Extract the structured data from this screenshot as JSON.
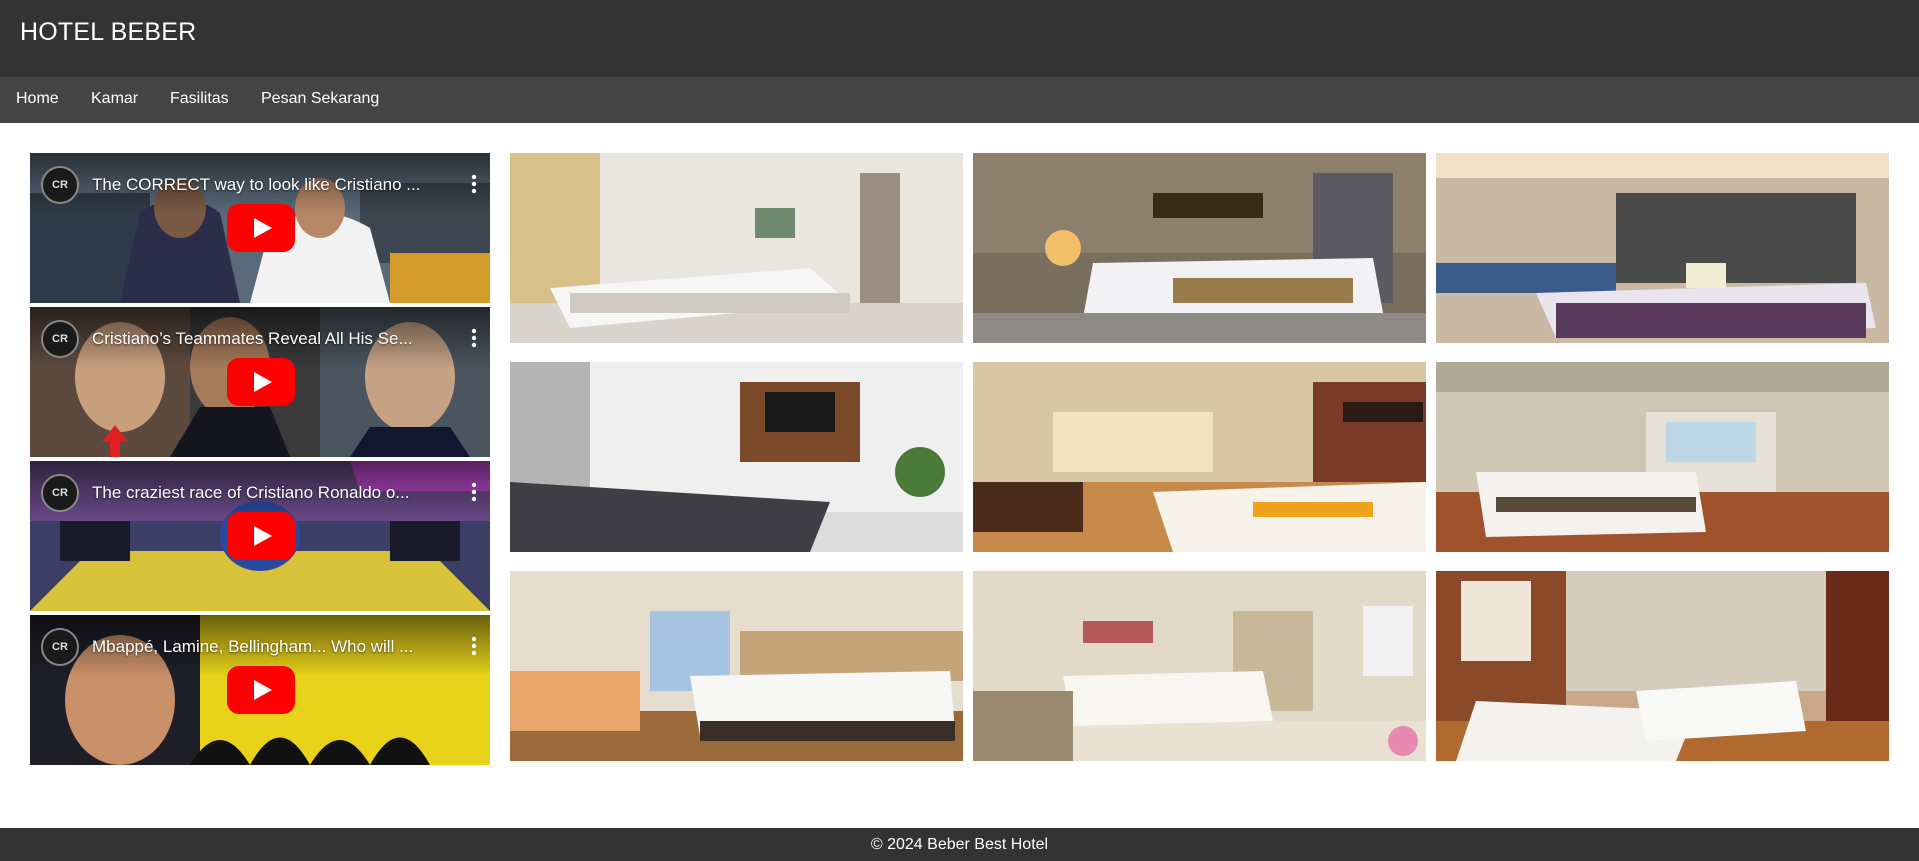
{
  "header": {
    "title": "HOTEL BEBER"
  },
  "nav": {
    "items": [
      {
        "label": "Home"
      },
      {
        "label": "Kamar"
      },
      {
        "label": "Fasilitas"
      },
      {
        "label": "Pesan Sekarang"
      }
    ]
  },
  "videos": [
    {
      "title": "The CORRECT way to look like Cristiano ...",
      "channel_badge": "CR"
    },
    {
      "title": "Cristiano’s Teammates Reveal All His Se...",
      "channel_badge": "CR"
    },
    {
      "title": "The craziest race of Cristiano Ronaldo o...",
      "channel_badge": "CR"
    },
    {
      "title": "Mbappé, Lamine, Bellingham... Who will ...",
      "channel_badge": "CR"
    }
  ],
  "rooms": [
    {
      "name": "room-photo-1"
    },
    {
      "name": "room-photo-2"
    },
    {
      "name": "room-photo-3"
    },
    {
      "name": "room-photo-4"
    },
    {
      "name": "room-photo-5"
    },
    {
      "name": "room-photo-6"
    },
    {
      "name": "room-photo-7"
    },
    {
      "name": "room-photo-8"
    },
    {
      "name": "room-photo-9"
    }
  ],
  "colors": {
    "header_bg": "#333333",
    "nav_bg": "#444444",
    "footer_bg": "#333333",
    "play_button": "#ff0000"
  },
  "footer": {
    "text": "© 2024 Beber Best Hotel"
  }
}
